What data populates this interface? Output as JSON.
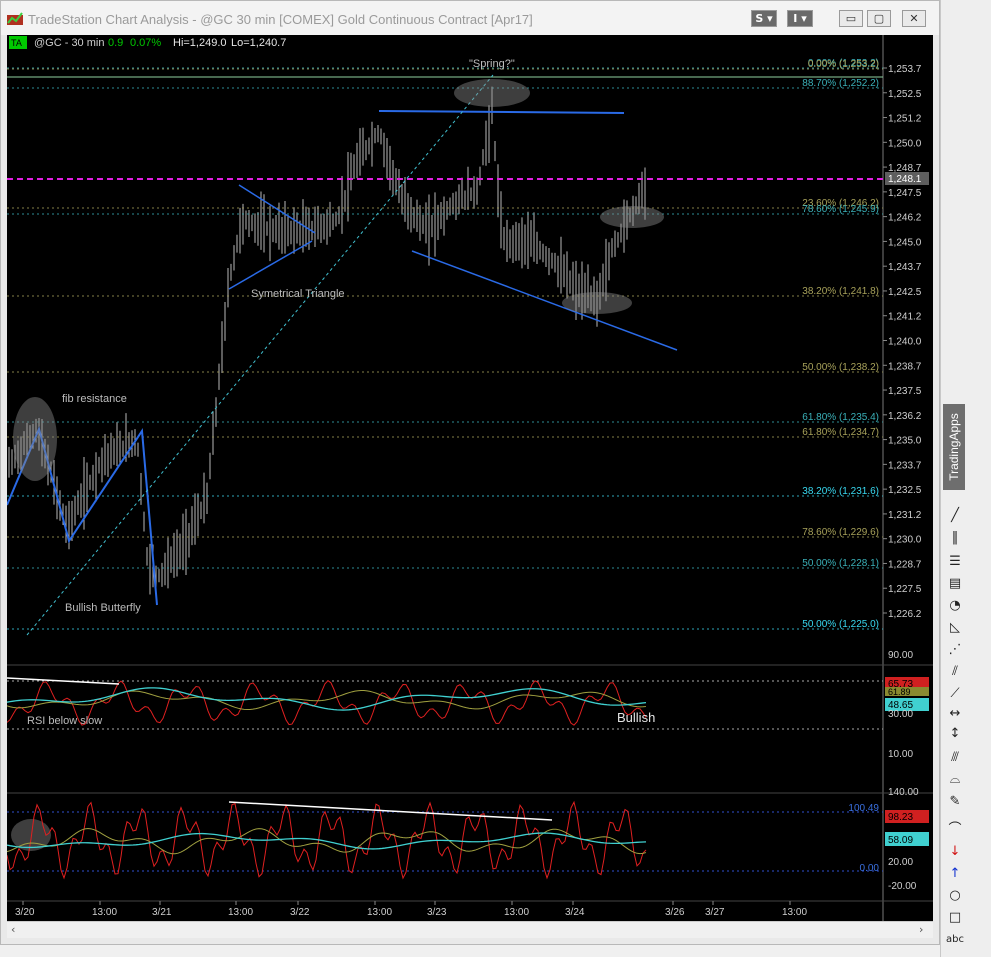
{
  "window": {
    "title": "TradeStation Chart Analysis - @GC 30 min [COMEX] Gold Continuous Contract [Apr17]",
    "buttons": {
      "s_label": "S ▾",
      "i_label": "I ▾",
      "min": "▭",
      "max": "▢",
      "close": "✕"
    }
  },
  "header": {
    "badge": "TA",
    "symbol": "@GC - 30 min",
    "change": "0.9",
    "change_pct": "0.07%",
    "hi": "Hi=1,249.0",
    "lo": "Lo=1,240.7"
  },
  "colors": {
    "up": "#00c800",
    "blue": "#2a6ae6",
    "magenta": "#e020e0",
    "fib_olive": "#a09a50",
    "fib_cyan": "#40c8d8"
  },
  "price_axis": [
    "1,253.7",
    "1,252.5",
    "1,251.2",
    "1,250.0",
    "1,248.7",
    "1,247.5",
    "1,246.2",
    "1,245.0",
    "1,243.7",
    "1,242.5",
    "1,241.2",
    "1,240.0",
    "1,238.7",
    "1,237.5",
    "1,236.2",
    "1,235.0",
    "1,233.7",
    "1,232.5",
    "1,231.2",
    "1,230.0",
    "1,228.7",
    "1,227.5",
    "1,226.2"
  ],
  "last_price": "1,248.1",
  "fib_labels": [
    {
      "text": "0.00% (1,253.2)",
      "c": "cyan"
    },
    {
      "text": "0.00% (1,253.2)",
      "c": "olive"
    },
    {
      "text": "88.70% (1,252.2)",
      "c": "cyan"
    },
    {
      "text": "23.60% (1,246.2)",
      "c": "olive"
    },
    {
      "text": "78.60% (1,245.9)",
      "c": "cyan"
    },
    {
      "text": "38.20% (1,241.8)",
      "c": "olive"
    },
    {
      "text": "50.00% (1,238.2)",
      "c": "olive"
    },
    {
      "text": "61.80% (1,235.4)",
      "c": "cyan"
    },
    {
      "text": "61.80% (1,234.7)",
      "c": "olive"
    },
    {
      "text": "38.20% (1,231.6)",
      "c": "cyanb"
    },
    {
      "text": "78.60% (1,229.6)",
      "c": "olive"
    },
    {
      "text": "50.00% (1,228.1)",
      "c": "cyan"
    },
    {
      "text": "50.00% (1,225.0)",
      "c": "cyanb"
    }
  ],
  "annotations": {
    "spring": "\"Spring?\"",
    "fib_resistance": "fib resistance",
    "sym_triangle": "Symetrical Triangle",
    "bullish_butterfly": "Bullish Butterfly",
    "rsi_below_slow": "RSI below slow",
    "bullish": "Bullish"
  },
  "rsi_axis": [
    "90.00",
    "30.00",
    "10.00"
  ],
  "rsi_values": {
    "v1": "65.73",
    "v2": "61.89",
    "v3": "48.65"
  },
  "osc_axis": [
    "140.00",
    "100.49",
    "20.00",
    "0.00",
    "-20.00"
  ],
  "osc_values": {
    "v1": "98.23",
    "v2": "58.09"
  },
  "time_axis": [
    "3/20",
    "13:00",
    "3/21",
    "13:00",
    "3/22",
    "13:00",
    "3/23",
    "13:00",
    "3/24",
    "3/26",
    "3/27",
    "13:00"
  ],
  "side_panel": {
    "tab": "TradingApps",
    "text_tool": "abc"
  }
}
